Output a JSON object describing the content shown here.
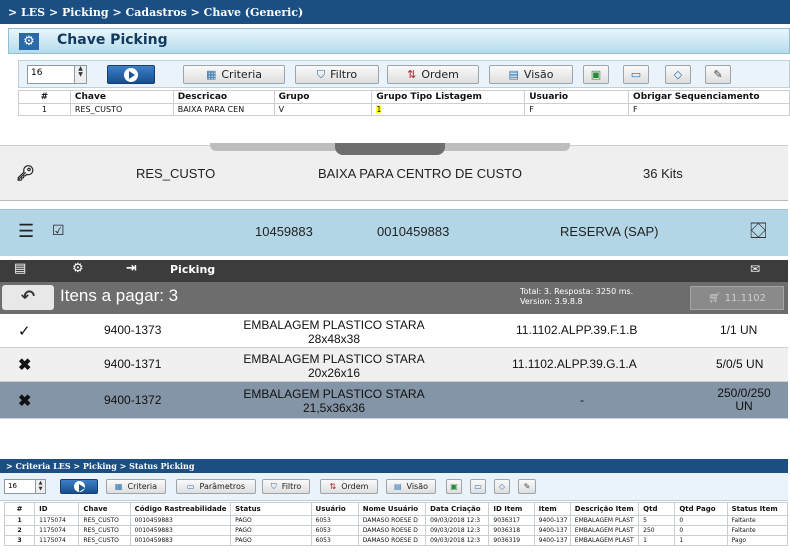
{
  "top": {
    "breadcrumb": "> LES > Picking > Cadastros > Chave (Generic)",
    "title": "Chave Picking",
    "page_size": "16",
    "buttons": {
      "criteria": "Criteria",
      "filtro": "Filtro",
      "ordem": "Ordem",
      "visao": "Visão"
    },
    "columns": [
      "#",
      "Chave",
      "Descricao",
      "Grupo",
      "Grupo Tipo Listagem",
      "Usuario",
      "Obrigar Sequenciamento"
    ],
    "rows": [
      [
        "1",
        "RES_CUSTO",
        "BAIXA PARA CEN",
        "V",
        "1",
        "F",
        "F"
      ]
    ]
  },
  "mobile": {
    "chave": "RES_CUSTO",
    "descricao": "BAIXA PARA CENTRO DE CUSTO",
    "kits": "36 Kits",
    "num1": "10459883",
    "num2": "0010459883",
    "reserva": "RESERVA (SAP)",
    "app_title": "Picking",
    "itens_header": "Itens a pagar: 3",
    "total_line": "Total: 3. Resposta: 3250 ms.",
    "version_line": "Version: 3.9.8.8",
    "cart_label": "11.1102",
    "items": [
      {
        "status_icon": "double-check",
        "code": "9400-1373",
        "desc1": "EMBALAGEM PLASTICO STARA",
        "desc2": "28x48x38",
        "loc": "11.1102.ALPP.39.F.1.B",
        "qty": "1/1 UN"
      },
      {
        "status_icon": "cross",
        "code": "9400-1371",
        "desc1": "EMBALAGEM PLASTICO STARA",
        "desc2": "20x26x16",
        "loc": "11.1102.ALPP.39.G.1.A",
        "qty": "5/0/5 UN"
      },
      {
        "status_icon": "cross",
        "code": "9400-1372",
        "desc1": "EMBALAGEM PLASTICO STARA",
        "desc2": "21,5x36x36",
        "loc": "-",
        "qty": "250/0/250 UN"
      }
    ]
  },
  "bottom": {
    "breadcrumb": "> Criteria LES > Picking > Status Picking",
    "page_size": "16",
    "buttons": {
      "criteria": "Criteria",
      "parametros": "Parâmetros",
      "filtro": "Filtro",
      "ordem": "Ordem",
      "visao": "Visão"
    },
    "columns": [
      "#",
      "ID",
      "Chave",
      "Código Rastreabilidade",
      "Status",
      "Usuário",
      "Nome Usuário",
      "Data Criação",
      "ID Item",
      "Item",
      "Descrição Item",
      "Qtd",
      "Qtd Pago",
      "Status Item"
    ],
    "rows": [
      [
        "1",
        "1175074",
        "RES_CUSTO",
        "0010459883",
        "PAGO",
        "6053",
        "DAMASO ROESE D",
        "09/03/2018 12:3",
        "9036317",
        "9400-137",
        "EMBALAGEM PLAST",
        "5",
        "0",
        "Faltante"
      ],
      [
        "2",
        "1175074",
        "RES_CUSTO",
        "0010459883",
        "PAGO",
        "6053",
        "DAMASO ROESE D",
        "09/03/2018 12:3",
        "9036318",
        "9400-137",
        "EMBALAGEM PLAST",
        "250",
        "0",
        "Faltante"
      ],
      [
        "3",
        "1175074",
        "RES_CUSTO",
        "0010459883",
        "PAGO",
        "6053",
        "DAMASO ROESE D",
        "09/03/2018 12:3",
        "9036319",
        "9400-137",
        "EMBALAGEM PLAST",
        "1",
        "1",
        "Pago"
      ]
    ]
  }
}
